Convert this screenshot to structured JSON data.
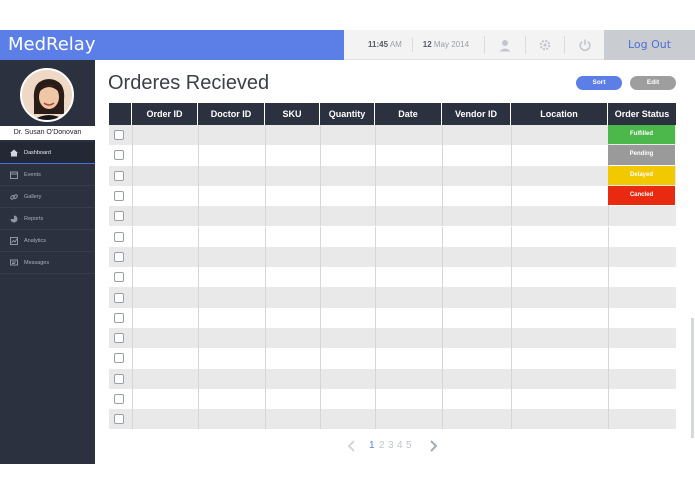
{
  "app": {
    "brand": "MedRelay"
  },
  "topbar": {
    "time": "11:45",
    "ampm": "AM",
    "day": "12",
    "month_year": "May 2014",
    "logout_label": "Log Out",
    "icons": [
      "user-icon",
      "gear-icon",
      "power-icon"
    ]
  },
  "sidebar": {
    "user_name": "Dr. Susan O'Donovan",
    "items": [
      {
        "label": "Dashboard",
        "icon": "home-icon",
        "active": true
      },
      {
        "label": "Events",
        "icon": "calendar-icon",
        "active": false
      },
      {
        "label": "Gallery",
        "icon": "link-icon",
        "active": false
      },
      {
        "label": "Reports",
        "icon": "pie-icon",
        "active": false
      },
      {
        "label": "Analytics",
        "icon": "chart-icon",
        "active": false
      },
      {
        "label": "Messages",
        "icon": "message-icon",
        "active": false
      }
    ]
  },
  "main": {
    "title": "Orderes Recieved",
    "sort_label": "Sort",
    "edit_label": "Edit",
    "columns": [
      "Order ID",
      "Doctor  ID",
      "SKU",
      "Quantity",
      "Date",
      "Vendor ID",
      "Location",
      "Order Status"
    ],
    "row_count": 15,
    "statuses": [
      {
        "label": "Fulfilled",
        "color": "#4cb84c"
      },
      {
        "label": "Pending",
        "color": "#9a9a9a"
      },
      {
        "label": "Delayed",
        "color": "#f2c800"
      },
      {
        "label": "Cancled",
        "color": "#ea2a10"
      }
    ]
  },
  "pagination": {
    "pages": [
      "1",
      "2",
      "3",
      "4",
      "5"
    ],
    "current": "1"
  },
  "colors": {
    "accent": "#5b7fe6",
    "sidebar": "#2c3140"
  }
}
